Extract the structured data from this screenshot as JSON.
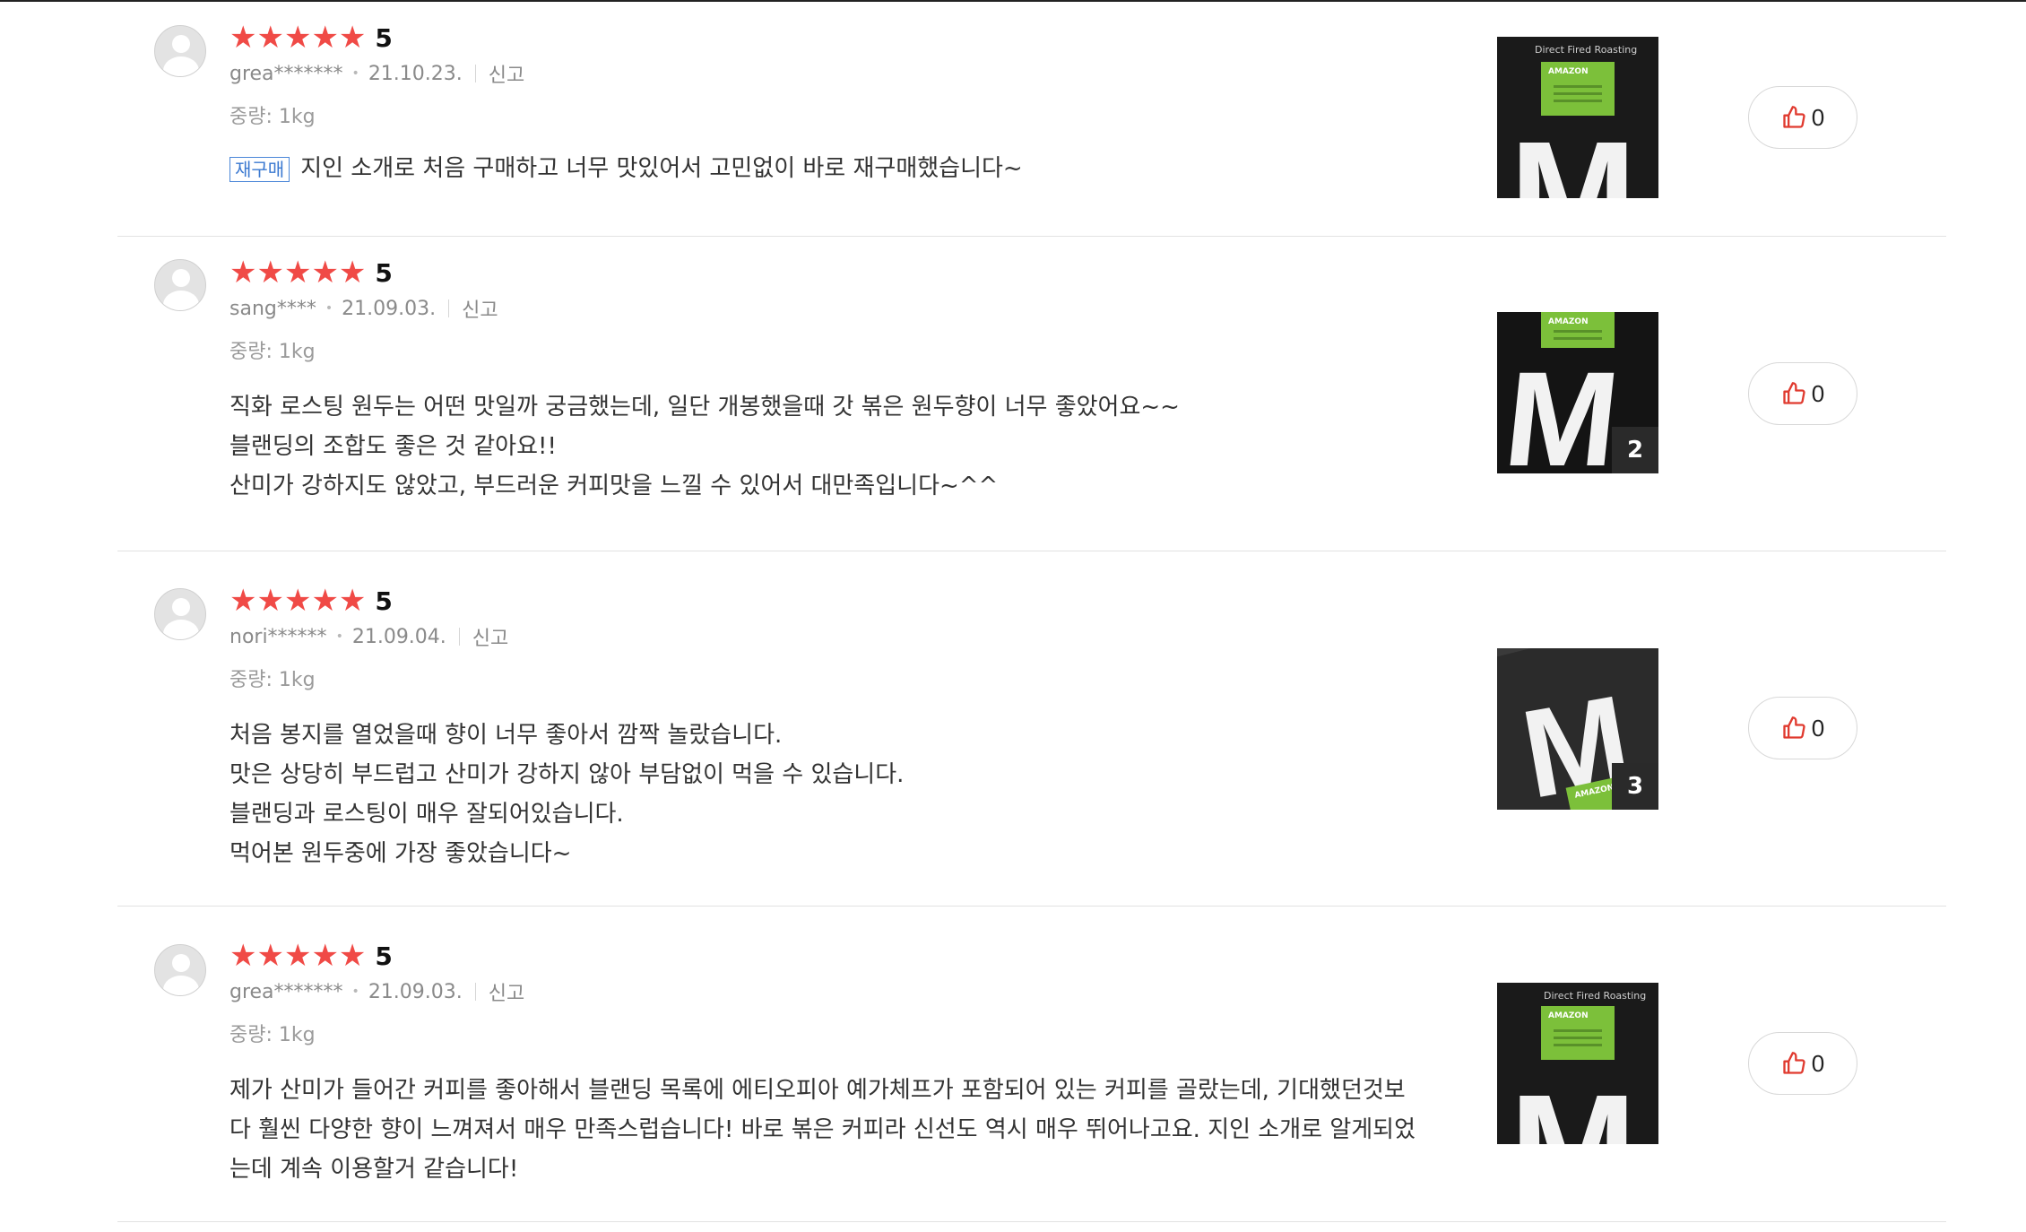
{
  "reviews": [
    {
      "stars": "★★★★★",
      "score": "5",
      "user": "grea*******",
      "date": "21.10.23.",
      "report": "신고",
      "weight": "중량: 1kg",
      "tag": "재구매",
      "text": "지인 소개로 처음 구매하고 너무 맛있어서 고민없이 바로 재구매했습니다~",
      "likes": "0"
    },
    {
      "stars": "★★★★★",
      "score": "5",
      "user": "sang****",
      "date": "21.09.03.",
      "report": "신고",
      "weight": "중량: 1kg",
      "text": "직화 로스팅 원두는 어떤 맛일까 궁금했는데, 일단 개봉했을때 갓 볶은 원두향이 너무 좋았어요~~\n블랜딩의 조합도 좋은 것 같아요!!\n산미가 강하지도 않았고, 부드러운 커피맛을 느낄 수 있어서 대만족입니다~^^",
      "image_count": "2",
      "likes": "0"
    },
    {
      "stars": "★★★★★",
      "score": "5",
      "user": "nori******",
      "date": "21.09.04.",
      "report": "신고",
      "weight": "중량: 1kg",
      "text": "처음 봉지를 열었을때 향이 너무 좋아서 깜짝 놀랐습니다.\n맛은 상당히 부드럽고 산미가 강하지 않아 부담없이 먹을 수 있습니다.\n블랜딩과 로스팅이 매우 잘되어있습니다.\n먹어본 원두중에 가장 좋았습니다~",
      "image_count": "3",
      "likes": "0"
    },
    {
      "stars": "★★★★★",
      "score": "5",
      "user": "grea*******",
      "date": "21.09.03.",
      "report": "신고",
      "weight": "중량: 1kg",
      "text": "제가 산미가 들어간 커피를 좋아해서 블랜딩 목록에 에티오피아 예가체프가 포함되어 있는  커피를 골랐는데, 기대했던것보\n다 훨씬 다양한 향이 느껴져서 매우 만족스럽습니다! 바로 볶은 커피라 신선도 역시 매우 뛰어나고요. 지인 소개로 알게되었\n는데 계속 이용할거 같습니다!",
      "likes": "0"
    }
  ],
  "product_image": {
    "top_text_1": "Direct Fired Roasting",
    "brand": "AMAZON",
    "letter": "M"
  },
  "colors": {
    "star": "#f04a46",
    "repurchase": "#3a78d0",
    "like_icon": "#e03a2f"
  },
  "icons": {
    "avatar": "user-avatar-icon",
    "like": "thumbs-up-icon"
  }
}
